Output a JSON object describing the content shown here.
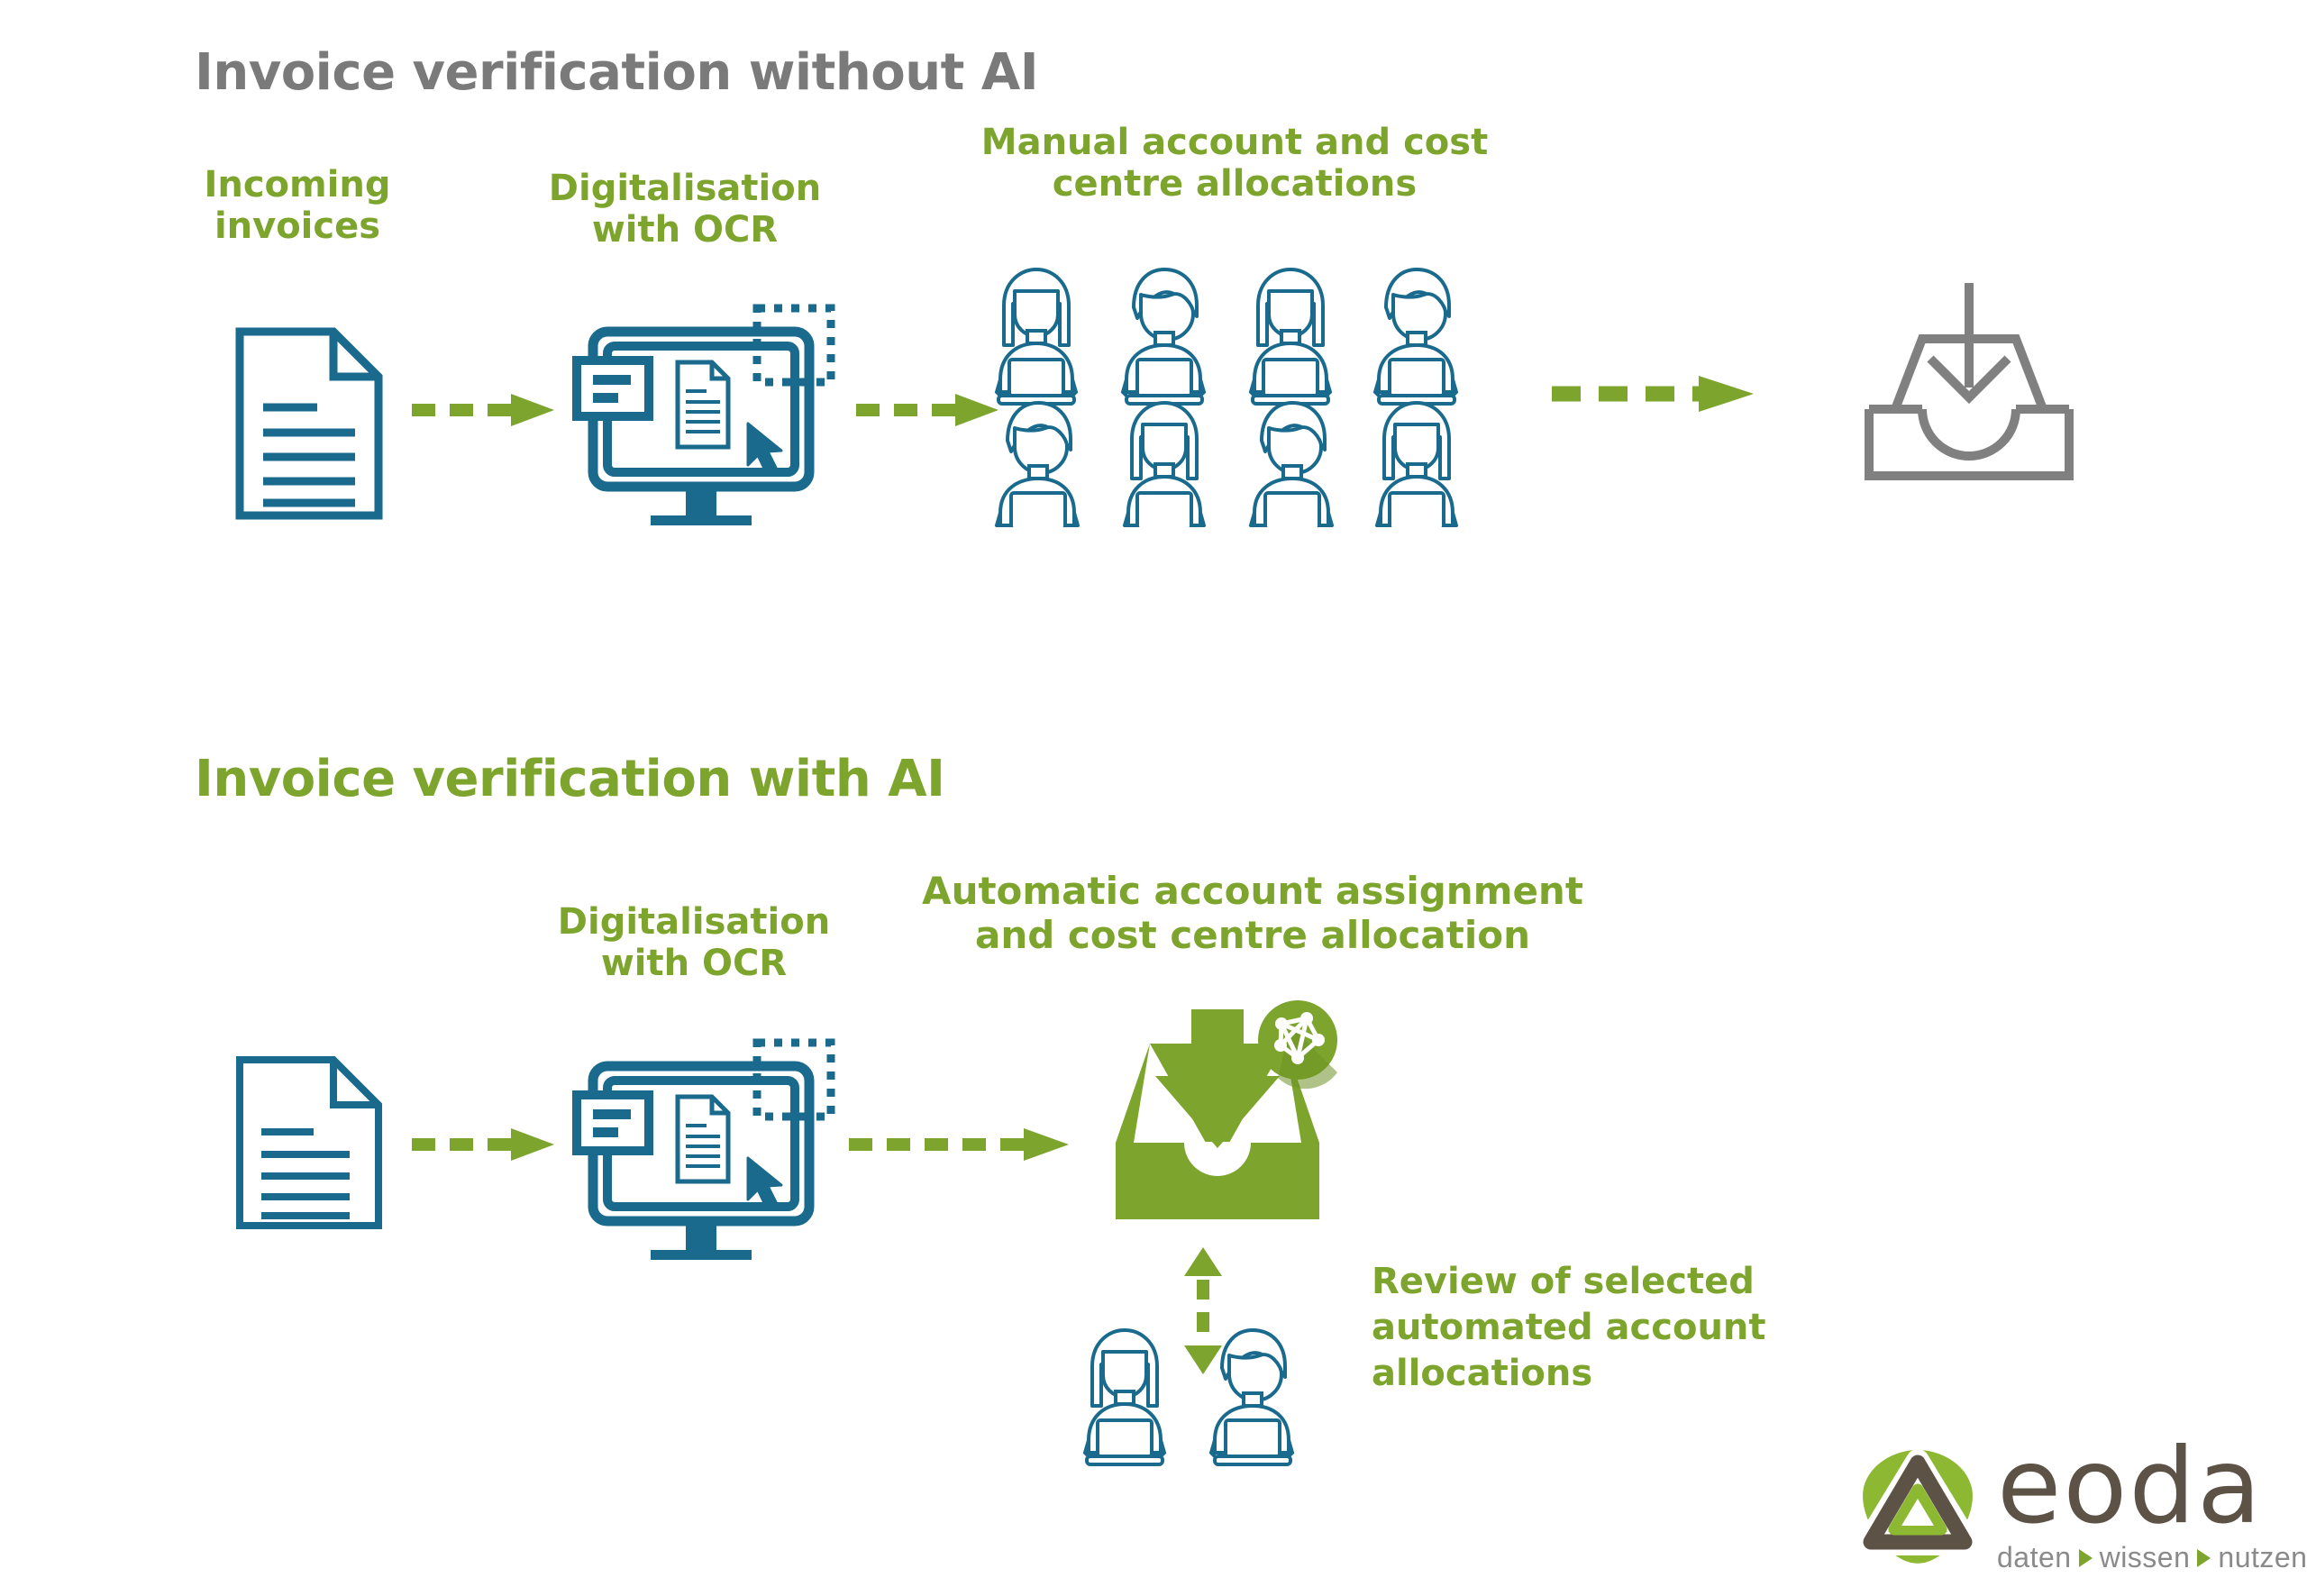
{
  "colors": {
    "green": "#7da42c",
    "green_dark": "#6e9127",
    "blue": "#1a6a8e",
    "gray": "#7a7a7a",
    "logo_brown": "#5d5246",
    "logo_gray": "#8a8a8a",
    "background": "#ffffff"
  },
  "section_without_ai": {
    "title": "Invoice verification without AI",
    "steps": [
      {
        "caption": "Incoming\ninvoices",
        "icon": "document-icon"
      },
      {
        "caption": "Digitalisation\nwith OCR",
        "icon": "ocr-monitor-icon"
      },
      {
        "caption": "Manual account and cost\ncentre allocations",
        "icon": "people-grid-icon",
        "people_count": 8
      },
      {
        "caption": "",
        "icon": "inbox-tray-icon"
      }
    ],
    "arrows": [
      {
        "name": "arrow-doc-to-ocr",
        "direction": "right",
        "style": "dashed"
      },
      {
        "name": "arrow-ocr-to-people",
        "direction": "right",
        "style": "dashed"
      },
      {
        "name": "arrow-people-to-inbox",
        "direction": "right",
        "style": "dashed"
      }
    ],
    "people": [
      {
        "row": 1,
        "gender": "female"
      },
      {
        "row": 1,
        "gender": "male"
      },
      {
        "row": 1,
        "gender": "female"
      },
      {
        "row": 1,
        "gender": "male"
      },
      {
        "row": 2,
        "gender": "male"
      },
      {
        "row": 2,
        "gender": "female"
      },
      {
        "row": 2,
        "gender": "male"
      },
      {
        "row": 2,
        "gender": "female"
      }
    ]
  },
  "section_with_ai": {
    "title": "Invoice verification with AI",
    "steps": [
      {
        "caption": "",
        "icon": "document-icon"
      },
      {
        "caption": "Digitalisation\nwith OCR",
        "icon": "ocr-monitor-icon"
      },
      {
        "caption": "Automatic account assignment\nand cost centre allocation",
        "icon": "ai-inbox-icon",
        "badge": "ai-network-badge"
      }
    ],
    "review": {
      "caption": "Review of selected\nautomated account\nallocations",
      "icon": "two-people-icon",
      "arrow": {
        "name": "arrow-bidirectional-review",
        "direction": "both",
        "style": "dashed"
      }
    },
    "arrows": [
      {
        "name": "arrow-doc-to-ocr-ai",
        "direction": "right",
        "style": "dashed"
      },
      {
        "name": "arrow-ocr-to-ai-inbox",
        "direction": "right",
        "style": "dashed"
      }
    ],
    "people": [
      {
        "gender": "female"
      },
      {
        "gender": "male"
      }
    ]
  },
  "logo": {
    "name": "eoda",
    "wordmark": "eoda",
    "tagline_parts": [
      "daten",
      "wissen",
      "nutzen"
    ],
    "separator": "triangle-right-icon"
  }
}
